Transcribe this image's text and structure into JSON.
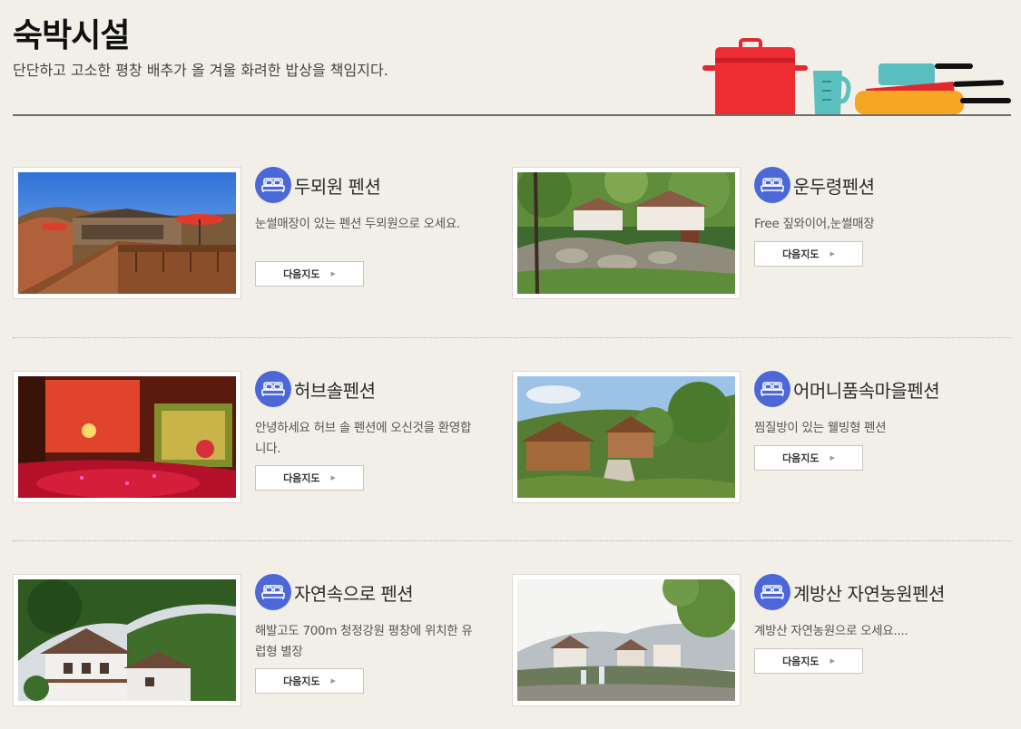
{
  "header": {
    "title": "숙박시설",
    "subtitle": "단단하고 고소한 평창 배추가 올 겨울 화려한 밥상을 책임지다."
  },
  "button_label": "다음지도",
  "listings": [
    {
      "name": "두뫼원 펜션",
      "desc": "눈썰매장이 있는 펜션 두뫼원으로 오세요."
    },
    {
      "name": "운두령펜션",
      "desc": "Free 짚와이어,눈썰매장"
    },
    {
      "name": "허브솔펜션",
      "desc": "안녕하세요 허브 솔 펜션에 오신것을 환영합니다."
    },
    {
      "name": "어머니품속마을펜션",
      "desc": "찜질방이 있는 웰빙형 펜션"
    },
    {
      "name": "자연속으로 펜션",
      "desc": "해발고도 700m 청정강원 평창에 위치한 유럽형 별장"
    },
    {
      "name": "계방산 자연농원펜션",
      "desc": "계방산 자연농원으로 오세요...."
    }
  ],
  "colors": {
    "accent_icon": "#4b67d8",
    "background": "#f2efe9"
  },
  "icons": {
    "listing": "bed-icon",
    "button": "arrow-right-icon"
  }
}
